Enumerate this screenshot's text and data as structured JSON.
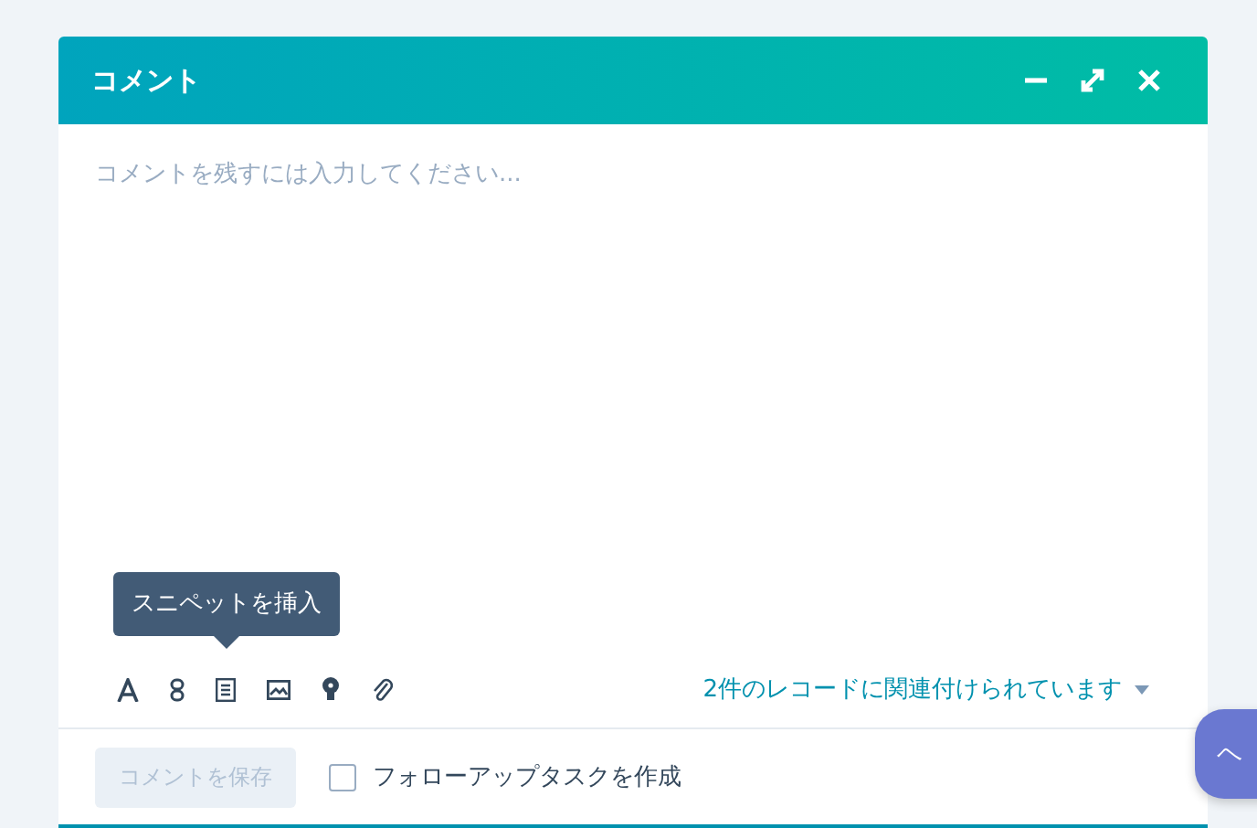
{
  "dialog": {
    "title": "コメント"
  },
  "editor": {
    "placeholder": "コメントを残すには入力してください..."
  },
  "tooltip": {
    "text": "スニペットを挿入"
  },
  "associations": {
    "label": "2件のレコードに関連付けられています"
  },
  "footer": {
    "save_button": {
      "label": "コメントを保存",
      "disabled": true
    },
    "follow_up": {
      "label": "フォローアップタスクを作成",
      "checked": false
    }
  },
  "help_button": {
    "label": "ヘ"
  }
}
